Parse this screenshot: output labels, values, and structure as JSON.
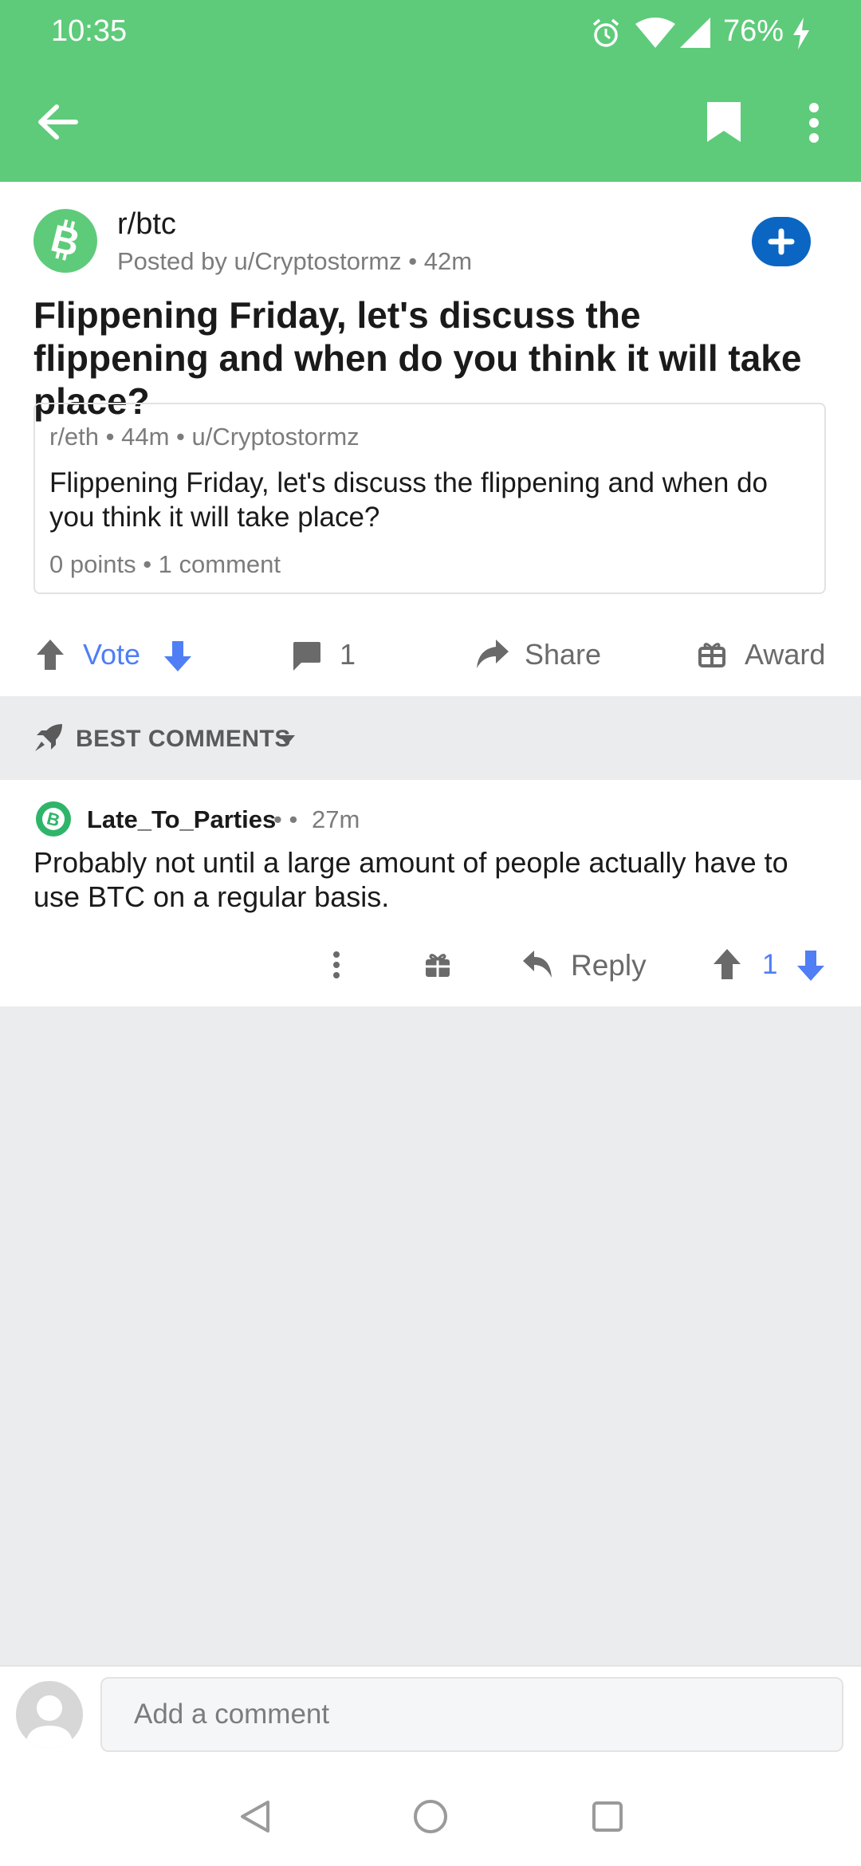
{
  "status_bar": {
    "time": "10:35",
    "battery": "76%",
    "icons": [
      "alarm-icon",
      "wifi-icon",
      "signal-icon",
      "charging-icon"
    ]
  },
  "toolbar": {
    "icons": [
      "back-arrow-icon",
      "bookmark-icon",
      "more-vert-icon"
    ],
    "accent_color": "#5ecb7a"
  },
  "post": {
    "subreddit": "r/btc",
    "posted_by": "Posted by u/Cryptostormz • 42m",
    "title": "Flippening Friday, let's discuss the flippening and when do you think it will take place?",
    "crosspost": {
      "meta": "r/eth • 44m • u/Cryptostormz",
      "title": "Flippening Friday, let's discuss the flippening and when do you think it will take place?",
      "stats": "0 points • 1 comment"
    },
    "actions": {
      "vote_label": "Vote",
      "comment_count": "1",
      "share_label": "Share",
      "award_label": "Award"
    }
  },
  "sort": {
    "label": "BEST COMMENTS"
  },
  "comments": [
    {
      "author": "Late_To_Parties",
      "separator": "•  •",
      "time": "27m",
      "body": "Probably not until a large amount of people actually have to use BTC on a regular basis.",
      "reply_label": "Reply",
      "score": "1"
    }
  ],
  "comment_bar": {
    "placeholder": "Add a comment"
  },
  "colors": {
    "header": "#5ecb7a",
    "upvote_blue": "#4f7ef5",
    "join_button": "#0a66c2"
  }
}
